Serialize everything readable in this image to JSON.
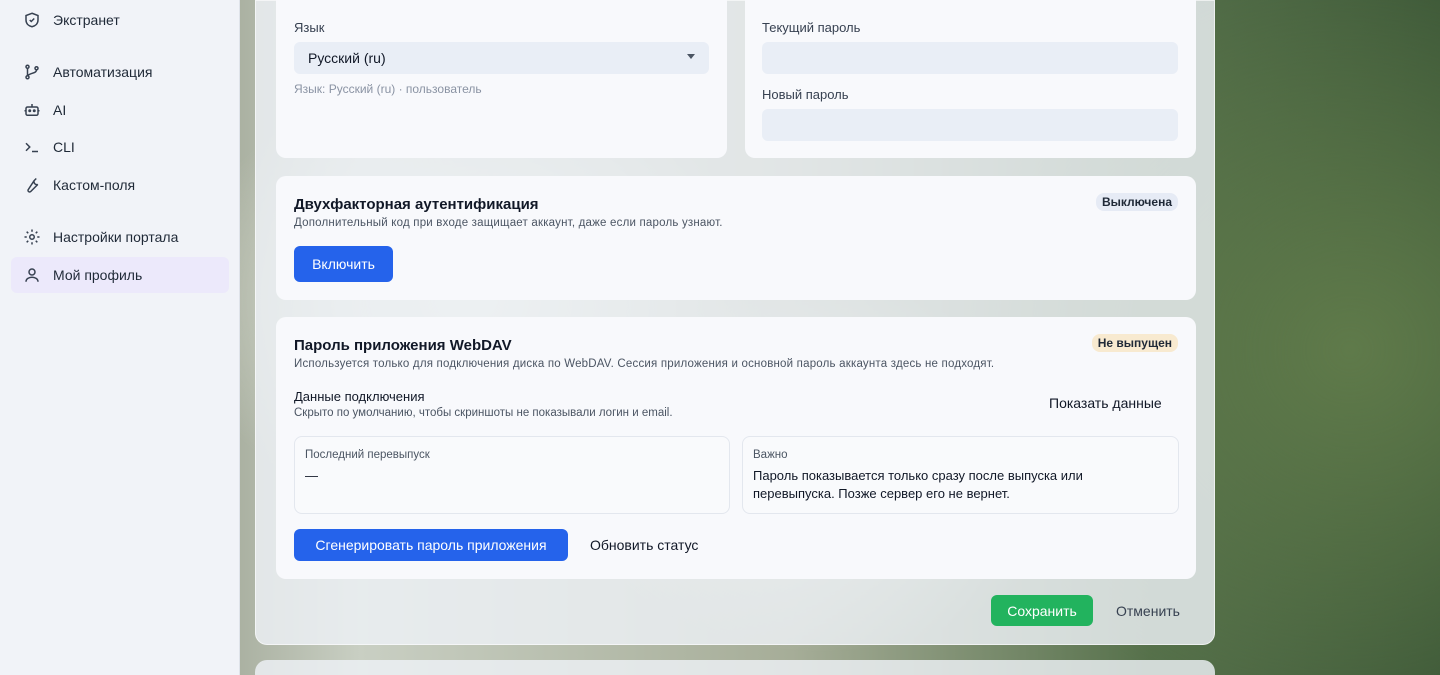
{
  "sidebar": {
    "items": [
      {
        "label": "Экстранет",
        "icon": "shield-icon"
      },
      {
        "label": "Автоматизация",
        "icon": "git-branch-icon"
      },
      {
        "label": "AI",
        "icon": "robot-icon"
      },
      {
        "label": "CLI",
        "icon": "terminal-icon"
      },
      {
        "label": "Кастом-поля",
        "icon": "wrench-icon"
      },
      {
        "label": "Настройки портала",
        "icon": "gear-icon"
      },
      {
        "label": "Мой профиль",
        "icon": "user-icon",
        "active": true
      }
    ]
  },
  "language": {
    "label": "Язык",
    "selected": "Русский (ru)",
    "hint": "Язык: Русский (ru) · пользователь"
  },
  "password": {
    "current_label": "Текущий пароль",
    "current_value": "",
    "new_label": "Новый пароль",
    "new_value": ""
  },
  "two_factor": {
    "title": "Двухфакторная аутентификация",
    "description": "Дополнительный код при входе защищает аккаунт, даже если пароль узнают.",
    "status": "Выключена",
    "status_color": "#e6ebf5",
    "enable_label": "Включить"
  },
  "webdav": {
    "title": "Пароль приложения WebDAV",
    "description": "Используется только для подключения диска по WebDAV. Сессия приложения и основной пароль аккаунта здесь не подходят.",
    "status": "Не выпущен",
    "status_color": "#f8ead0",
    "connection_title": "Данные подключения",
    "connection_desc": "Скрыто по умолчанию, чтобы скриншоты не показывали логин и email.",
    "show_label": "Показать данные",
    "last_reissue_label": "Последний перевыпуск",
    "last_reissue_value": "—",
    "important_label": "Важно",
    "important_value": "Пароль показывается только сразу после выпуска или перевыпуска. Позже сервер его не вернет.",
    "generate_label": "Сгенерировать пароль приложения",
    "refresh_label": "Обновить статус"
  },
  "footer": {
    "save_label": "Сохранить",
    "cancel_label": "Отменить"
  },
  "colors": {
    "primary": "#2563eb",
    "success": "#22b35e",
    "active_nav": "#ece9fb"
  }
}
